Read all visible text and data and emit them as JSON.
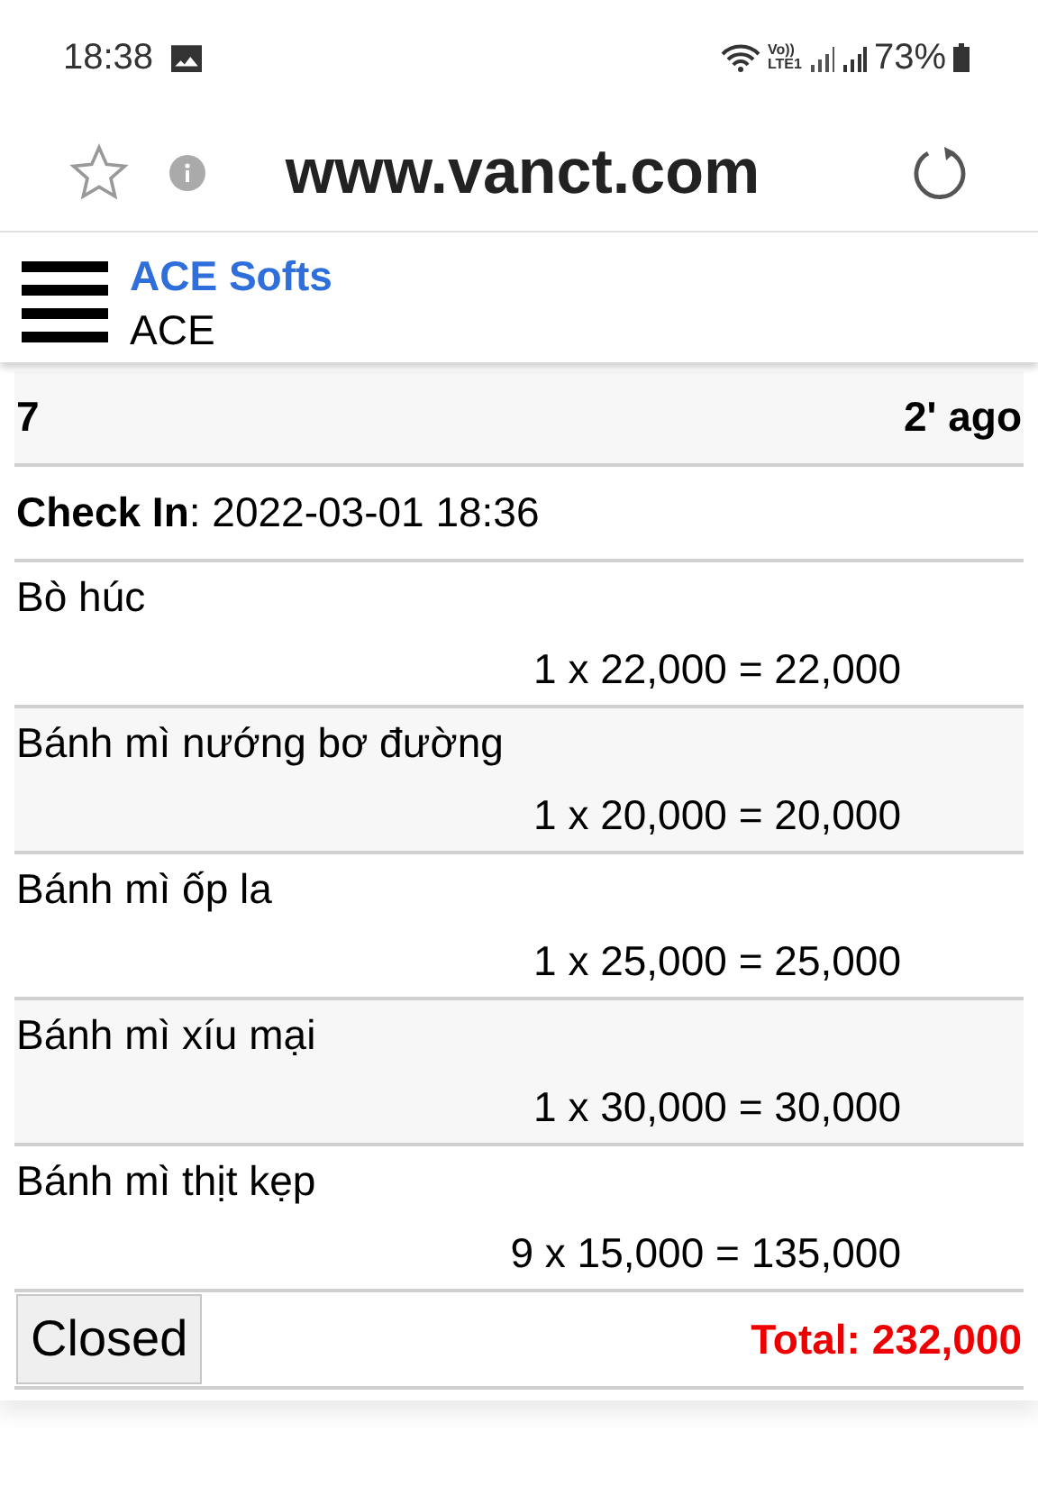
{
  "status_bar": {
    "time": "18:38",
    "volte": "Vo))",
    "lte": "LTE1",
    "battery": "73%"
  },
  "browser": {
    "url": "www.vanct.com"
  },
  "header": {
    "title": "ACE Softs",
    "subtitle": "ACE"
  },
  "order": {
    "number": "7",
    "age": "2' ago",
    "check_in_label": "Check In",
    "check_in_value": ": 2022-03-01 18:36",
    "items": [
      {
        "name": "Bò húc",
        "line": "1 x 22,000 = 22,000"
      },
      {
        "name": "Bánh mì nướng bơ đường",
        "line": "1 x 20,000 = 20,000"
      },
      {
        "name": "Bánh mì ốp la",
        "line": "1 x 25,000 = 25,000"
      },
      {
        "name": "Bánh mì xíu mại",
        "line": "1 x 30,000 = 30,000"
      },
      {
        "name": "Bánh mì thịt kẹp",
        "line": "9 x 15,000 = 135,000"
      }
    ],
    "status_button": "Closed",
    "total": "Total: 232,000"
  }
}
